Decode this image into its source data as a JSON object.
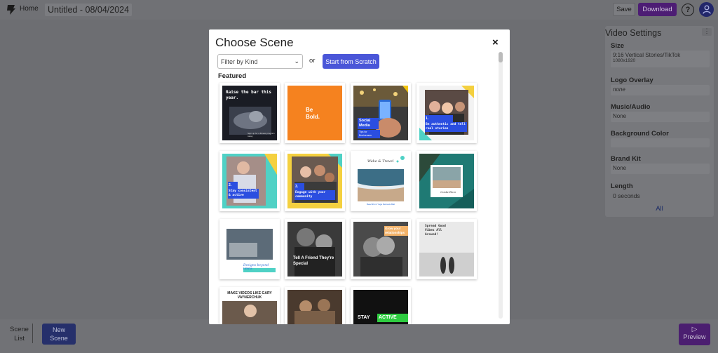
{
  "app": {
    "home_label": "Home",
    "project_title": "Untitled - 08/04/2024",
    "save_label": "Save",
    "download_label": "Download",
    "help_glyph": "?"
  },
  "video_settings": {
    "title": "Video Settings",
    "menu_glyph": "⋮",
    "size_label": "Size",
    "size_value": "9:16 Vertical Stories/TikTok",
    "size_resolution": "1080x1920",
    "logo_label": "Logo Overlay",
    "logo_value": "none",
    "music_label": "Music/Audio",
    "music_value": "None",
    "bg_label": "Background Color",
    "bg_value": "",
    "brand_label": "Brand Kit",
    "brand_value": "None",
    "length_label": "Length",
    "length_value": "0 seconds",
    "all_link": "All"
  },
  "bottom": {
    "scene_list_line1": "Scene",
    "scene_list_line2": "List",
    "new_scene_line1": "New",
    "new_scene_line2": "Scene",
    "preview_icon": "▷",
    "preview_label": "Preview"
  },
  "modal": {
    "title": "Choose Scene",
    "close_glyph": "×",
    "filter_placeholder": "Filter by Kind",
    "or_label": "or",
    "scratch_label": "Start from Scratch",
    "featured_label": "Featured"
  },
  "scenes": [
    {
      "text": "Raise the bar this year.",
      "caption": "Sign up for a fitness program today.",
      "bg": "#1a1c24"
    },
    {
      "text": "Be Bold.",
      "bg": "#f5821f"
    },
    {
      "text": "Social Media",
      "sub": "Tips for Businesses",
      "bg": "#3a3a3a"
    },
    {
      "num": "1.",
      "text": "Be authentic and tell real stories",
      "bg": "#2e2e2e"
    },
    {
      "num": "2.",
      "text": "Stay consistent & active",
      "bg": "#4fd1c5"
    },
    {
      "num": "3.",
      "text": "Engage with your community",
      "bg": "#4fd1c5"
    },
    {
      "text": "Wake & Travel",
      "caption": "Beachfront Yoga Retreats Bali",
      "bg": "#ffffff"
    },
    {
      "text": "Costa Rica",
      "bg": "#1f7a74"
    },
    {
      "text": "Designs beyond limits",
      "bg": "#ffffff"
    },
    {
      "text": "Tell A Friend They're Special",
      "bg": "#2a2a2a"
    },
    {
      "text": "Grow your relationships",
      "bg": "#555555"
    },
    {
      "text": "Spread Good Vibes All Around!",
      "bg": "#e9e9e9"
    },
    {
      "text": "MAKE VIDEOS LIKE GARY VAYNERCHUK",
      "bg": "#ffffff"
    },
    {
      "text": "",
      "bg": "#5a4a3c"
    },
    {
      "text": "STAY",
      "text2": "ACTIVE",
      "bg": "#111111"
    }
  ]
}
